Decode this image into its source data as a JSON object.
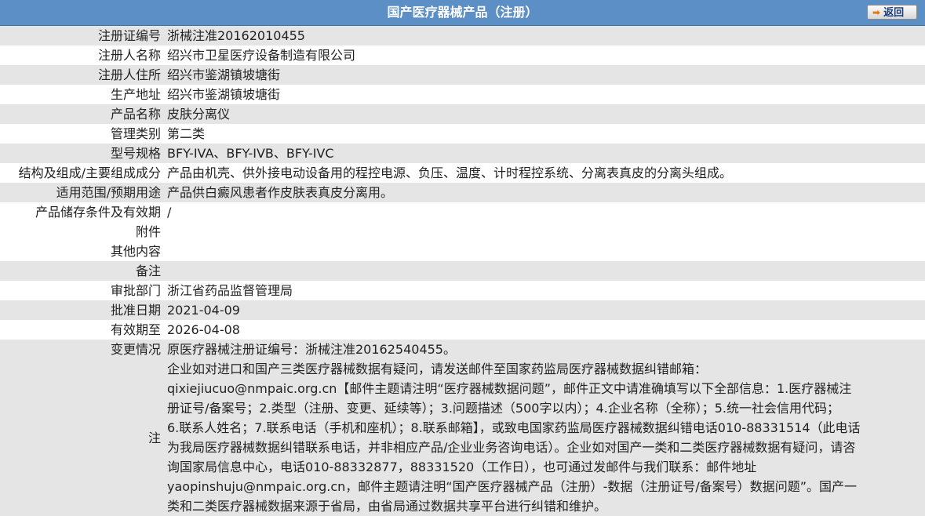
{
  "header": {
    "title": "国产医疗器械产品（注册）",
    "back_label": "返回"
  },
  "rows": [
    {
      "label": "注册证编号",
      "value": "浙械注准20162010455"
    },
    {
      "label": "注册人名称",
      "value": "绍兴市卫星医疗设备制造有限公司"
    },
    {
      "label": "注册人住所",
      "value": "绍兴市鉴湖镇坡塘街"
    },
    {
      "label": "生产地址",
      "value": "绍兴市鉴湖镇坡塘街"
    },
    {
      "label": "产品名称",
      "value": "皮肤分离仪"
    },
    {
      "label": "管理类别",
      "value": "第二类"
    },
    {
      "label": "型号规格",
      "value": "BFY-IVA、BFY-IVB、BFY-IVC"
    },
    {
      "label": "结构及组成/主要组成成分",
      "value": "产品由机壳、供外接电动设备用的程控电源、负压、温度、计时程控系统、分离表真皮的分离头组成。"
    },
    {
      "label": "适用范围/预期用途",
      "value": "产品供白癜风患者作皮肤表真皮分离用。"
    },
    {
      "label": "产品储存条件及有效期",
      "value": "/"
    },
    {
      "label": "附件",
      "value": ""
    },
    {
      "label": "其他内容",
      "value": ""
    },
    {
      "label": "备注",
      "value": ""
    },
    {
      "label": "审批部门",
      "value": "浙江省药品监督管理局"
    },
    {
      "label": "批准日期",
      "value": "2021-04-09"
    },
    {
      "label": "有效期至",
      "value": "2026-04-08"
    },
    {
      "label": "变更情况",
      "value": "原医疗器械注册证编号：浙械注准20162540455。"
    }
  ],
  "note": {
    "label": "注",
    "lines": [
      "企业如对进口和国产三类医疗器械数据有疑问，请发送邮件至国家药监局医疗器械数据纠错邮箱：",
      "qixiejiucuo@nmpaic.org.cn【邮件主题请注明“医疗器械数据问题”，邮件正文中请准确填写以下全部信息：1.医疗器械注",
      "册证号/备案号；2.类型（注册、变更、延续等）；3.问题描述（500字以内）；4.企业名称（全称）；5.统一社会信用代码；",
      "6.联系人姓名；7.联系电话（手机和座机）；8.联系邮箱】，或致电国家药监局医疗器械数据纠错电话010-88331514（此电话",
      "为我局医疗器械数据纠错联系电话，并非相应产品/企业业务咨询电话）。企业如对国产一类和二类医疗器械数据有疑问，请咨",
      "询国家局信息中心，电话010-88332877，88331520（工作日），也可通过发邮件与我们联系：邮件地址",
      "yaopinshuju@nmpaic.org.cn，邮件主题请注明“国产医疗器械产品（注册）-数据（注册证号/备案号）数据问题”。国产一",
      "类和二类医疗器械数据来源于省局，由省局通过数据共享平台进行纠错和维护。"
    ]
  }
}
